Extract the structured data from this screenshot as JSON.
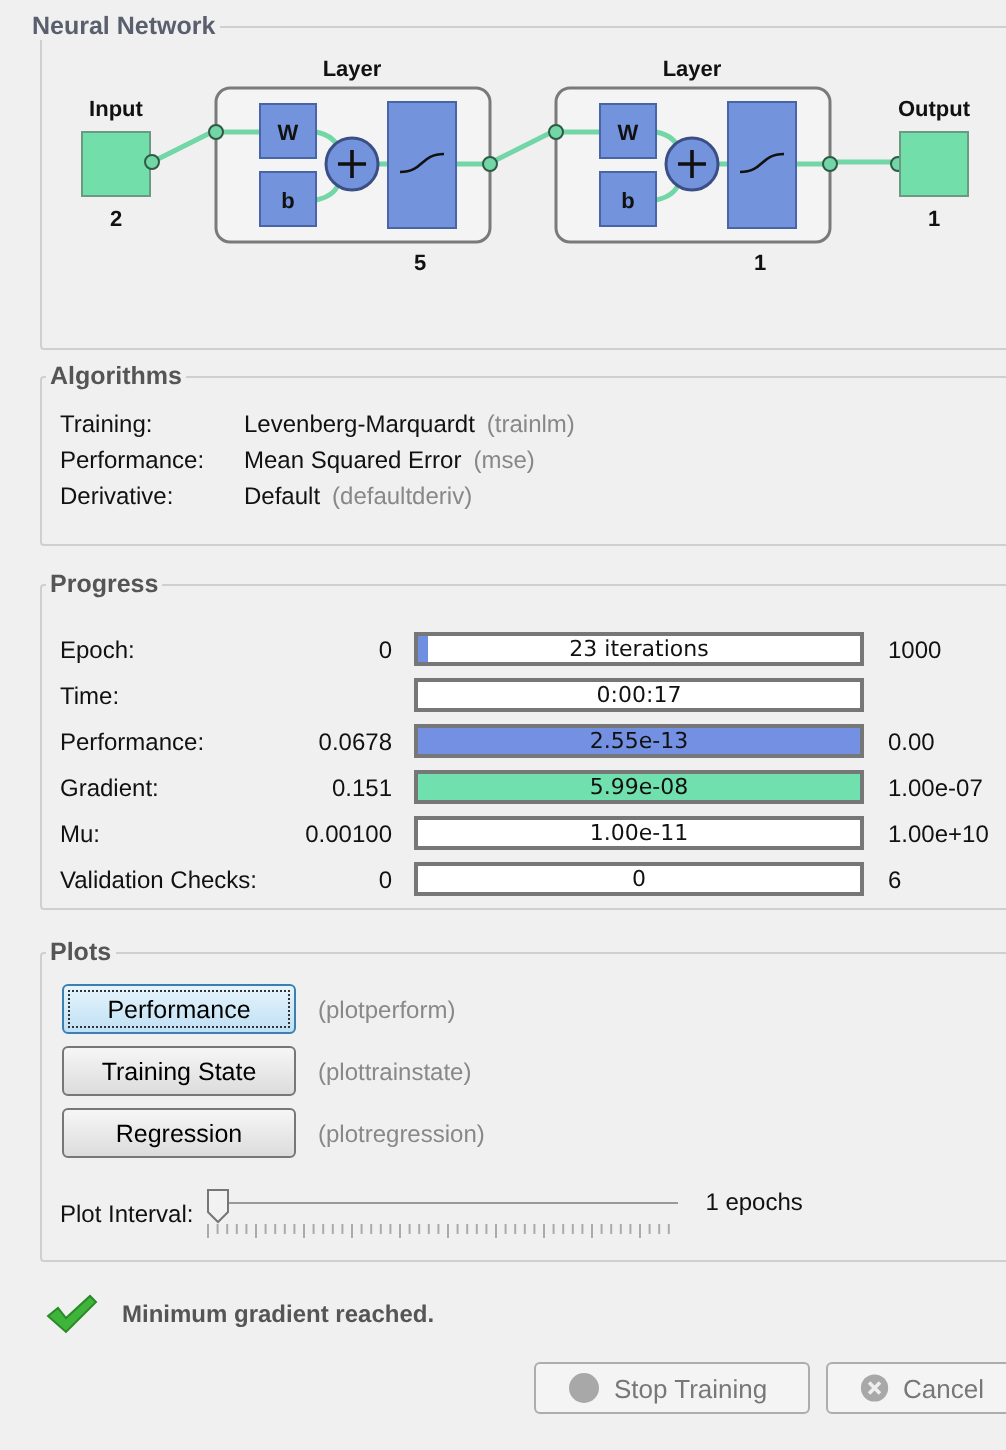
{
  "network": {
    "title": "Neural Network",
    "input": {
      "label": "Input",
      "size": "2"
    },
    "layers": [
      {
        "title": "Layer",
        "weight": "W",
        "bias": "b",
        "size": "5"
      },
      {
        "title": "Layer",
        "weight": "W",
        "bias": "b",
        "size": "1"
      }
    ],
    "output": {
      "label": "Output",
      "size": "1"
    }
  },
  "algorithms": {
    "title": "Algorithms",
    "rows": [
      {
        "label": "Training:",
        "value": "Levenberg-Marquardt",
        "code": "(trainlm)"
      },
      {
        "label": "Performance:",
        "value": "Mean Squared Error",
        "code": "(mse)"
      },
      {
        "label": "Derivative:",
        "value": "Default",
        "code": "(defaultderiv)"
      }
    ]
  },
  "progress": {
    "title": "Progress",
    "rows": [
      {
        "label": "Epoch:",
        "start": "0",
        "reading": "23 iterations",
        "level": 0.023,
        "color": "#6f8fe3",
        "end": "1000"
      },
      {
        "label": "Time:",
        "reading": "0:00:17",
        "level": 0
      },
      {
        "label": "Performance:",
        "start": "0.0678",
        "reading": "2.55e-13",
        "level": 1,
        "color": "#7390e2",
        "end": "0.00"
      },
      {
        "label": "Gradient:",
        "start": "0.151",
        "reading": "5.99e-08",
        "level": 1,
        "color": "#70e0ae",
        "end": "1.00e-07"
      },
      {
        "label": "Mu:",
        "start": "0.00100",
        "reading": "1.00e-11",
        "level": 0,
        "end": "1.00e+10"
      },
      {
        "label": "Validation Checks:",
        "start": "0",
        "reading": "0",
        "level": 0,
        "end": "6"
      }
    ]
  },
  "plots": {
    "title": "Plots",
    "buttons": [
      {
        "label": "Performance",
        "function": "(plotperform)",
        "focused": true
      },
      {
        "label": "Training State",
        "function": "(plottrainstate)",
        "focused": false
      },
      {
        "label": "Regression",
        "function": "(plotregression)",
        "focused": false
      }
    ],
    "interval": {
      "label": "Plot Interval:",
      "level": 0,
      "reading": "1 epochs"
    }
  },
  "status": {
    "message": "Minimum gradient reached."
  },
  "buttons": [
    {
      "label": "Stop Training",
      "kind": "stop",
      "disabled": true
    },
    {
      "label": "Cancel",
      "kind": "cancel",
      "disabled": true
    }
  ]
}
